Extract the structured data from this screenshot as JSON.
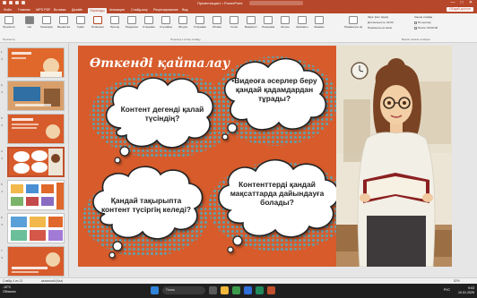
{
  "window": {
    "doc_title": "Презентация1 • PowerPoint",
    "controls": [
      "—",
      "□",
      "✕"
    ]
  },
  "tabs": [
    {
      "label": "Файл",
      "active": false
    },
    {
      "label": "Главная",
      "active": false
    },
    {
      "label": "WPS PDF",
      "active": false
    },
    {
      "label": "Вставка",
      "active": false
    },
    {
      "label": "Дизайн",
      "active": false
    },
    {
      "label": "Переходы",
      "active": true
    },
    {
      "label": "Анимация",
      "active": false
    },
    {
      "label": "Слайд-шоу",
      "active": false
    },
    {
      "label": "Рецензирование",
      "active": false
    },
    {
      "label": "Вид",
      "active": false
    }
  ],
  "share_label": "Общий доступ",
  "ribbon": {
    "preview_label": "Просмотр",
    "effects": [
      "Нет",
      "Трансформация",
      "Выцветание",
      "Сдвиг",
      "Появление",
      "Проход",
      "Разделение",
      "Открывание",
      "Случайные...",
      "Фигура",
      "Открывание",
      "Облако",
      "Сетка",
      "Видимость",
      "Панорама",
      "Шторы",
      "Шахматы",
      "Занавес"
    ],
    "group_preview": "Просмотр",
    "group_transitions": "Переход к этому слайду",
    "group_timing": "Время показа слайдов",
    "effect_params": "Параметры эффектов",
    "sound_label": "Звук:",
    "sound_value": "[Нет звука]",
    "duration_label": "Длительность:",
    "duration_value": "02,00",
    "apply_all": "Применить ко всем",
    "advance_label": "Смена слайда",
    "on_click": "По щелчку",
    "after_label": "После:",
    "after_value": "00:00,00"
  },
  "thumbnails": [
    {
      "num": "1"
    },
    {
      "num": "2"
    },
    {
      "num": "3"
    },
    {
      "num": "4",
      "selected": true
    },
    {
      "num": "5"
    },
    {
      "num": "6"
    },
    {
      "num": "7"
    }
  ],
  "slide": {
    "title": "Өткенді қайталау",
    "clouds": [
      {
        "text": "Контент дегенді қалай түсіндің?"
      },
      {
        "text": "•Видеоға әсерлер беру қандай қадамдардан тұрады?"
      },
      {
        "text": "Қандай тақырыпта контент түсіргің келеді?"
      },
      {
        "text": "Контенттерді қандай мақсаттарда дайындауға болады?"
      }
    ]
  },
  "status": {
    "slide_info": "Слайд 4 из 13",
    "language": "казахский (Каз)",
    "zoom": "82%"
  },
  "taskbar": {
    "weather_temp": "-10°C",
    "weather_desc": "Облачно",
    "search_label": "Поиск",
    "lang": "РУС",
    "time": "9:03",
    "date": "10.01.2025"
  },
  "colors": {
    "accent": "#b7472a",
    "slide_bg": "#d75b2b",
    "dots": "#6b9a9e"
  }
}
